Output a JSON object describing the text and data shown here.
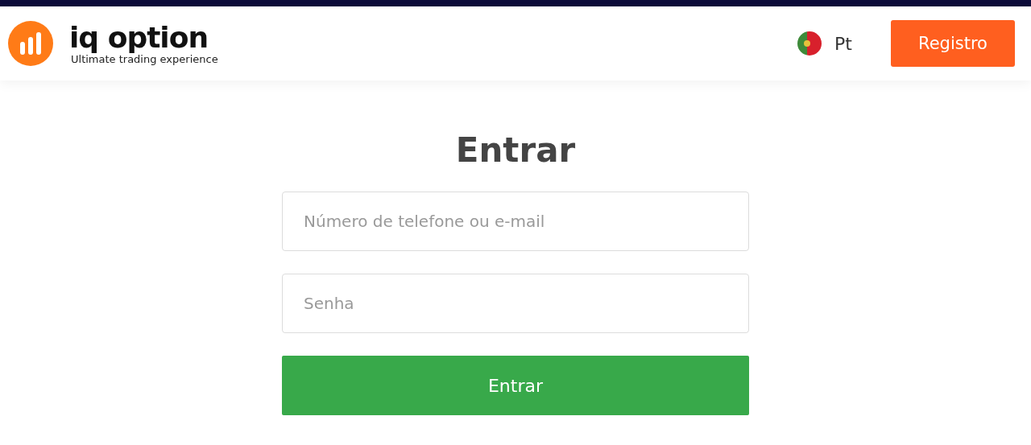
{
  "header": {
    "logo": {
      "name": "iq option",
      "tagline": "Ultimate trading experience"
    },
    "language": "Pt",
    "register_button": "Registro"
  },
  "login": {
    "title": "Entrar",
    "fields": [
      {
        "placeholder": "Número de telefone ou e-mail"
      },
      {
        "placeholder": "Senha"
      }
    ],
    "submit_button": "Entrar"
  }
}
